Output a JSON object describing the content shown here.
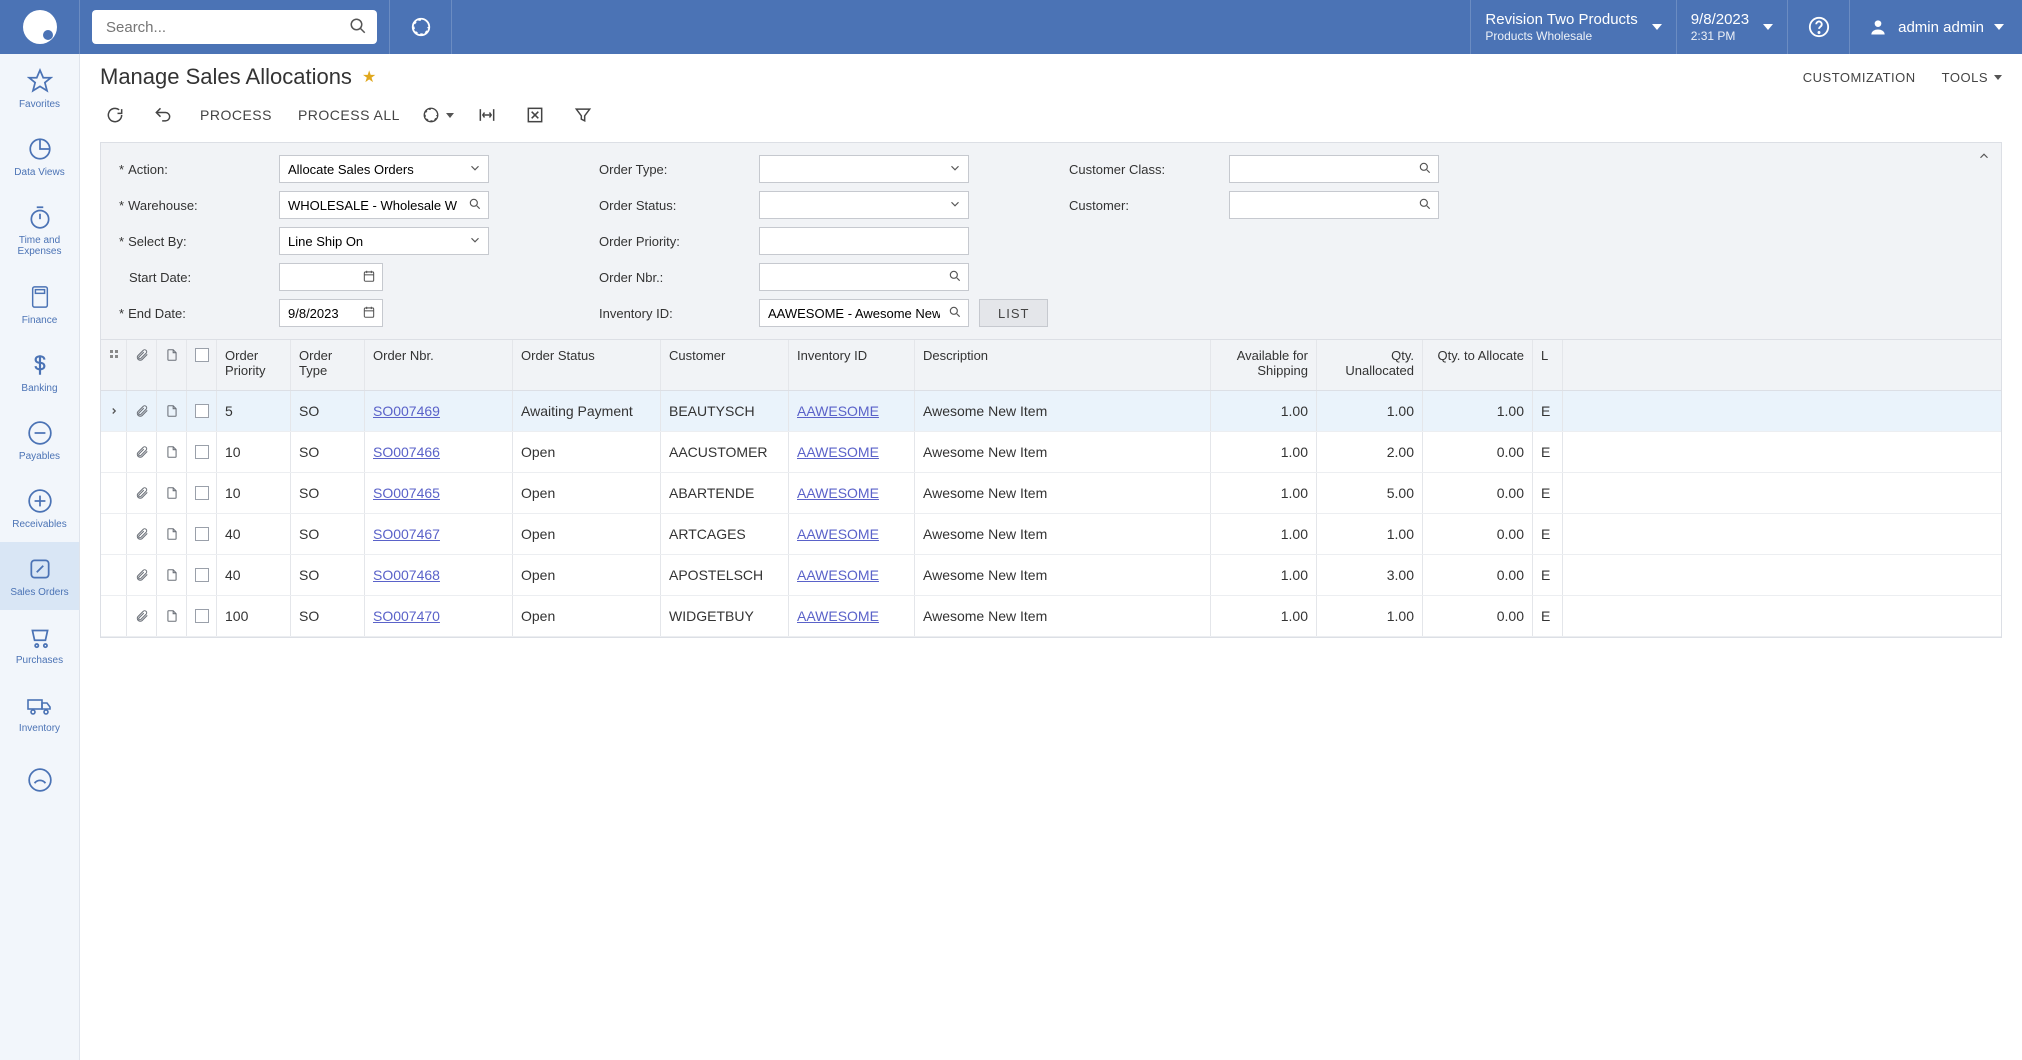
{
  "header": {
    "search_placeholder": "Search...",
    "tenant_top": "Revision Two Products",
    "tenant_bot": "Products Wholesale",
    "date": "9/8/2023",
    "time": "2:31 PM",
    "user_name": "admin admin"
  },
  "sidebar": {
    "items": [
      {
        "label": "Favorites",
        "icon": "star"
      },
      {
        "label": "Data Views",
        "icon": "pie"
      },
      {
        "label": "Time and Expenses",
        "icon": "stopwatch"
      },
      {
        "label": "Finance",
        "icon": "calculator"
      },
      {
        "label": "Banking",
        "icon": "dollar"
      },
      {
        "label": "Payables",
        "icon": "minus-circle"
      },
      {
        "label": "Receivables",
        "icon": "plus-circle"
      },
      {
        "label": "Sales Orders",
        "icon": "edit",
        "active": true
      },
      {
        "label": "Purchases",
        "icon": "cart"
      },
      {
        "label": "Inventory",
        "icon": "truck"
      }
    ]
  },
  "page": {
    "title": "Manage Sales Allocations",
    "customization_label": "CUSTOMIZATION",
    "tools_label": "TOOLS"
  },
  "toolbar": {
    "process": "PROCESS",
    "process_all": "PROCESS ALL"
  },
  "filters": {
    "labels": {
      "action": "Action:",
      "warehouse": "Warehouse:",
      "select_by": "Select By:",
      "start_date": "Start Date:",
      "end_date": "End Date:",
      "order_type": "Order Type:",
      "order_status": "Order Status:",
      "order_priority": "Order Priority:",
      "order_nbr": "Order Nbr.:",
      "inventory_id": "Inventory ID:",
      "customer_class": "Customer Class:",
      "customer": "Customer:"
    },
    "values": {
      "action": "Allocate Sales Orders",
      "warehouse": "WHOLESALE - Wholesale W",
      "select_by": "Line Ship On",
      "start_date": "",
      "end_date": "9/8/2023",
      "order_type": "",
      "order_status": "",
      "order_priority": "",
      "order_nbr": "",
      "inventory_id": "AAWESOME - Awesome New",
      "customer_class": "",
      "customer": ""
    },
    "list_btn": "LIST"
  },
  "grid": {
    "columns": {
      "order_priority": "Order Priority",
      "order_type": "Order Type",
      "order_nbr": "Order Nbr.",
      "order_status": "Order Status",
      "customer": "Customer",
      "inventory_id": "Inventory ID",
      "description": "Description",
      "available_for_shipping": "Available for Shipping",
      "qty_unallocated": "Qty. Unallocated",
      "qty_to_allocate": "Qty. to Allocate",
      "tail_partial": "L"
    },
    "rows": [
      {
        "priority": "5",
        "type": "SO",
        "nbr": "SO007469",
        "status": "Awaiting Payment",
        "customer": "BEAUTYSCH",
        "inventory": "AAWESOME",
        "desc": "Awesome New Item",
        "avail": "1.00",
        "unalloc": "1.00",
        "qtyto": "1.00",
        "tail": "E",
        "selected": true,
        "has_caret": true
      },
      {
        "priority": "10",
        "type": "SO",
        "nbr": "SO007466",
        "status": "Open",
        "customer": "AACUSTOMER",
        "inventory": "AAWESOME",
        "desc": "Awesome New Item",
        "avail": "1.00",
        "unalloc": "2.00",
        "qtyto": "0.00",
        "tail": "E"
      },
      {
        "priority": "10",
        "type": "SO",
        "nbr": "SO007465",
        "status": "Open",
        "customer": "ABARTENDE",
        "inventory": "AAWESOME",
        "desc": "Awesome New Item",
        "avail": "1.00",
        "unalloc": "5.00",
        "qtyto": "0.00",
        "tail": "E"
      },
      {
        "priority": "40",
        "type": "SO",
        "nbr": "SO007467",
        "status": "Open",
        "customer": "ARTCAGES",
        "inventory": "AAWESOME",
        "desc": "Awesome New Item",
        "avail": "1.00",
        "unalloc": "1.00",
        "qtyto": "0.00",
        "tail": "E"
      },
      {
        "priority": "40",
        "type": "SO",
        "nbr": "SO007468",
        "status": "Open",
        "customer": "APOSTELSCH",
        "inventory": "AAWESOME",
        "desc": "Awesome New Item",
        "avail": "1.00",
        "unalloc": "3.00",
        "qtyto": "0.00",
        "tail": "E"
      },
      {
        "priority": "100",
        "type": "SO",
        "nbr": "SO007470",
        "status": "Open",
        "customer": "WIDGETBUY",
        "inventory": "AAWESOME",
        "desc": "Awesome New Item",
        "avail": "1.00",
        "unalloc": "1.00",
        "qtyto": "0.00",
        "tail": "E"
      }
    ]
  }
}
